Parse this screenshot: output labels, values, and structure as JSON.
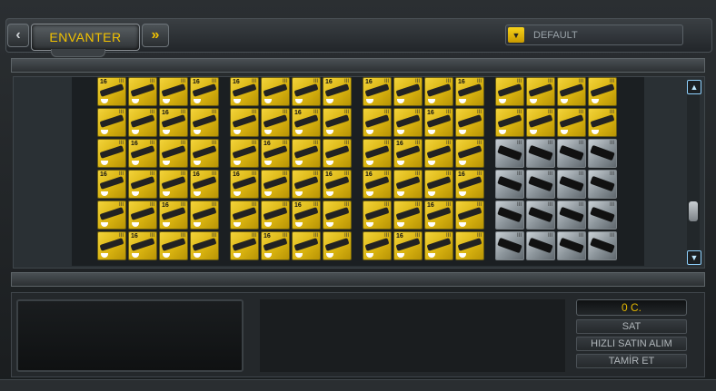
{
  "header": {
    "tab_label": "ENVANTER",
    "prev_icon": "chevron-left",
    "next_icon": "double-chevron-right"
  },
  "filter": {
    "selected": "DEFAULT",
    "arrow_color": "#f2c200"
  },
  "inventory": {
    "blocks": [
      {
        "cols": 4,
        "rows": 6,
        "type": "gold"
      },
      {
        "cols": 4,
        "rows": 6,
        "type": "gold"
      },
      {
        "cols": 4,
        "rows": 6,
        "type": "gold"
      },
      {
        "cols": 4,
        "rows": 6,
        "type": "mixed",
        "gold_rows": 2
      }
    ],
    "cell_level_labels": [
      "16",
      "1"
    ],
    "rank_label": "III"
  },
  "actions": {
    "price": "0 C.",
    "sell": "SAT",
    "quick_buy": "HIZLI SATIN ALIM",
    "repair": "TAMİR ET"
  },
  "colors": {
    "accent": "#f2c200",
    "gold_item": "#d9b310",
    "silver_item": "#8e979d"
  }
}
